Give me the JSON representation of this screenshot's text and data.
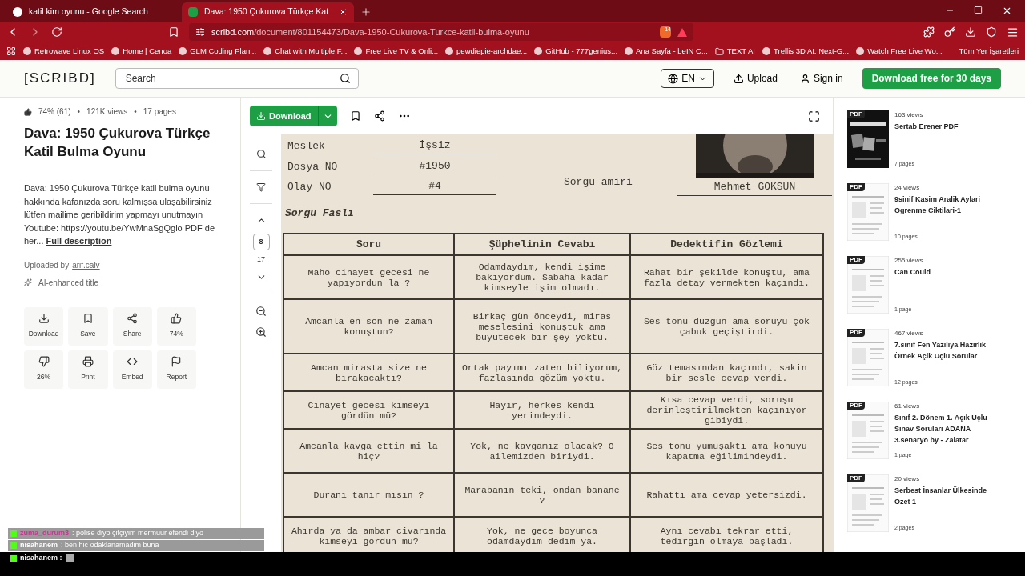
{
  "browser": {
    "tabs": [
      {
        "title": "katil kim oyunu - Google Search",
        "selected": false
      },
      {
        "title": "Dava: 1950 Çukurova Türkçe Kat",
        "selected": true
      }
    ],
    "url": {
      "host": "scribd.com",
      "path": "/document/801154473/Dava-1950-Cukurova-Turkce-katil-bulma-oyunu"
    },
    "extension_badge": "14",
    "bookmarks": [
      "Retrowave Linux OS",
      "Home | Cenoa",
      "GLM Coding Plan...",
      "Chat with Multiple F...",
      "Free Live TV & Onli...",
      "pewdiepie-archdae...",
      "GitHub - 777genius...",
      "Ana Sayfa - beIN C...",
      "TEXT AI",
      "Trellis 3D AI: Next-G...",
      "Watch Free Live Wo..."
    ],
    "all_bookmarks": "Tüm Yer İşaretleri"
  },
  "header": {
    "logo": "[SCRIBD]",
    "search_placeholder": "Search",
    "language": "EN",
    "upload": "Upload",
    "sign_in": "Sign in",
    "cta": "Download free for 30 days"
  },
  "document_info": {
    "rating": "74% (61)",
    "separator_1": "•",
    "views": "121K views",
    "separator_2": "•",
    "pages": "17 pages",
    "title": "Dava: 1950 Çukurova Türkçe Katil Bulma Oyunu",
    "description": "Dava: 1950 Çukurova Türkçe katil bulma oyunu hakkında kafanızda soru kalmışsa ulaşabilirsiniz lütfen mailime geribildirim yapmayı unutmayın Youtube: https://youtu.be/YwMnaSgQglo PDF de her...",
    "full_description": "Full description",
    "uploaded_by": "Uploaded by",
    "uploader": "arif.calv",
    "ai_note": "AI-enhanced title",
    "actions": [
      {
        "kind": "download",
        "label": "Download"
      },
      {
        "kind": "save",
        "label": "Save"
      },
      {
        "kind": "share",
        "label": "Share"
      },
      {
        "kind": "like",
        "label": "74%"
      },
      {
        "kind": "dislike",
        "label": "26%"
      },
      {
        "kind": "print",
        "label": "Print"
      },
      {
        "kind": "embed",
        "label": "Embed"
      },
      {
        "kind": "report",
        "label": "Report"
      }
    ]
  },
  "viewer": {
    "download": "Download",
    "current_page": "8",
    "total_pages": "17",
    "fields": [
      {
        "label": "Meslek",
        "value": "İşsiz"
      },
      {
        "label": "Dosya NO",
        "value": "#1950"
      },
      {
        "label": "Olay NO",
        "value": "#4"
      }
    ],
    "officer_label": "Sorgu amiri",
    "officer": "Mehmet GÖKSUN",
    "section": "Sorgu Faslı",
    "table": {
      "columns": [
        "Soru",
        "Şüphelinin Cevabı",
        "Dedektifin Gözlemi"
      ],
      "rows": [
        [
          "Maho cinayet gecesi ne yapıyordun la ?",
          "Odamdaydım, kendi işime bakıyordum. Sabaha kadar kimseyle işim olmadı.",
          "Rahat bir şekilde konuştu, ama fazla detay vermekten kaçındı."
        ],
        [
          "Amcanla en son ne zaman konuştun?",
          "Birkaç gün önceydi, miras meselesini konuştuk ama büyütecek bir şey yoktu.",
          "Ses tonu düzgün ama soruyu çok çabuk geçiştirdi."
        ],
        [
          "Amcan mirasta size ne bırakacaktı?",
          "Ortak payımı zaten biliyorum, fazlasında gözüm yoktu.",
          "Göz temasından kaçındı, sakin bir sesle cevap verdi."
        ],
        [
          "Cinayet gecesi kimseyi gördün mü?",
          "Hayır, herkes kendi yerindeydi.",
          "Kısa cevap verdi, soruşu derinleştirilmekten kaçınıyor gibiydi."
        ],
        [
          "Amcanla kavga ettin mi la hiç?",
          "Yok, ne kavgamız olacak? O ailemizden biriydi.",
          "Ses tonu yumuşaktı ama konuyu kapatma eğilimindeydi."
        ],
        [
          "Duranı tanır mısın ?",
          "Marabanın teki, ondan banane ?",
          "Rahattı ama cevap yetersizdi."
        ],
        [
          "Ahırda ya da ambar civarında kimseyi gördün mü?",
          "Yok, ne gece boyunca odamdaydım dedim ya.",
          "Aynı cevabı tekrar etti, tedirgin olmaya başladı."
        ]
      ]
    }
  },
  "related": [
    {
      "badge": "PDF",
      "views": "163 views",
      "title": "Sertab Erener PDF",
      "pages": "7 pages",
      "kind": "poster"
    },
    {
      "badge": "PDF",
      "views": "24 views",
      "title": "9sinif Kasim Aralik Aylari Ogrenme Ciktilari-1",
      "pages": "10 pages",
      "kind": "sheet"
    },
    {
      "badge": "PDF",
      "views": "255 views",
      "title": "Can Could",
      "pages": "1 page",
      "kind": "sheet"
    },
    {
      "badge": "PDF",
      "views": "467 views",
      "title": "7.sinif Fen Yaziliya Hazirlik Örnek Açik Uçlu Sorular",
      "pages": "12 pages",
      "kind": "sheet"
    },
    {
      "badge": "PDF",
      "views": "61 views",
      "title": "Sınıf 2. Dönem 1. Açık Uçlu Sınav Soruları ADANA 3.senaryo by - Zalatar",
      "pages": "1 page",
      "kind": "sheet"
    },
    {
      "badge": "PDF",
      "views": "20 views",
      "title": "Serbest İnsanlar Ülkesinde Özet 1",
      "pages": "2 pages",
      "kind": "sheet"
    }
  ],
  "chat": [
    {
      "user": "zuma_durum3",
      "message": ": polise diyo çifçiyim mermuur efendi diyo",
      "color": "#c0398f"
    },
    {
      "user": "nisahanem",
      "message": ": ben hic odaklanamadim buna",
      "color": "#ffffff"
    }
  ],
  "chat_input": {
    "user": "nisahanem :"
  }
}
